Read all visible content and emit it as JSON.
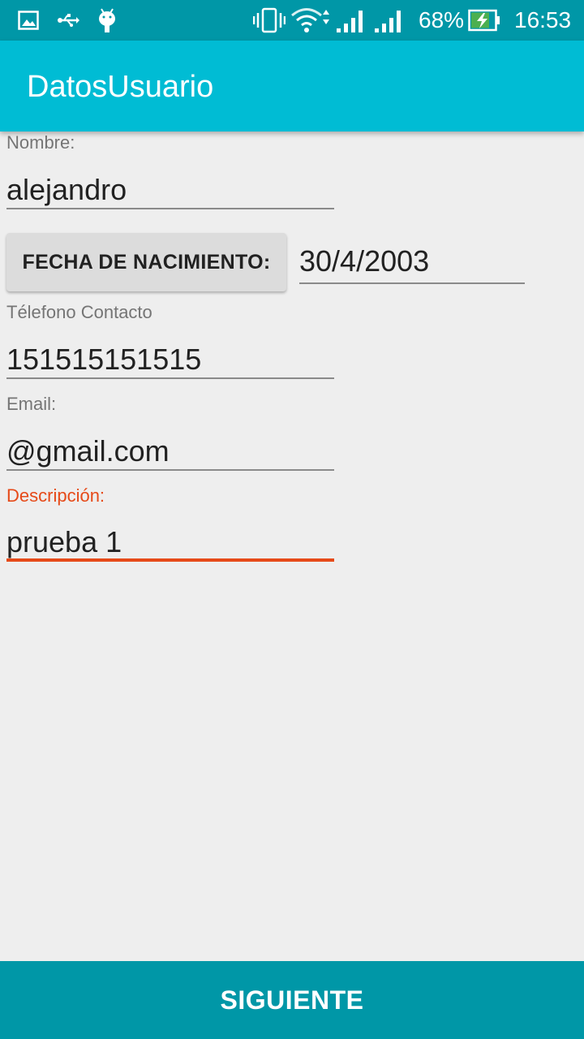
{
  "status_bar": {
    "battery_percent": "68%",
    "time": "16:53",
    "icons_left": [
      "image-icon",
      "usb-icon",
      "android-debug-icon"
    ],
    "icons_right": [
      "vibrate-icon",
      "wifi-icon",
      "signal-icon-1",
      "signal-icon-2",
      "battery-charging-icon"
    ]
  },
  "app_bar": {
    "title": "DatosUsuario"
  },
  "form": {
    "name": {
      "label": "Nombre:",
      "value": "alejandro"
    },
    "birthdate": {
      "button_label": "FECHA DE NACIMIENTO:",
      "value": "30/4/2003"
    },
    "phone": {
      "label": "Télefono Contacto",
      "value": "151515151515"
    },
    "email": {
      "label": "Email:",
      "value": "@gmail.com"
    },
    "description": {
      "label": "Descripción:",
      "value": "prueba 1"
    }
  },
  "footer": {
    "next_label": "SIGUIENTE"
  },
  "colors": {
    "status_bar": "#0097a7",
    "app_bar": "#00bcd4",
    "accent": "#e64a19",
    "background": "#eeeeee",
    "footer_button": "#0097a7"
  }
}
